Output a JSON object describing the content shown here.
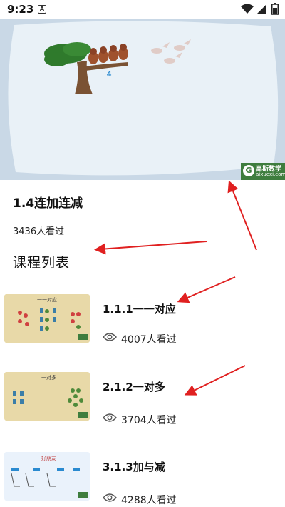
{
  "status_bar": {
    "time": "9:23",
    "notification_glyph": "A",
    "icons": [
      "wifi-icon",
      "signal-icon",
      "battery-icon"
    ]
  },
  "player": {
    "badge_number": "4",
    "watermark_name": "高斯数学",
    "watermark_url": "aixuexi.com",
    "watermark_logo": "G"
  },
  "course": {
    "title": "1.4连加连减",
    "views": "3436人看过"
  },
  "course_list": {
    "heading": "课程列表",
    "lessons": [
      {
        "title": "1.1.1一一对应",
        "views": "4007人看过",
        "thumb_caption": "一一对应"
      },
      {
        "title": "2.1.2一对多",
        "views": "3704人看过",
        "thumb_caption": "一对多"
      },
      {
        "title": "3.1.3加与减",
        "views": "4288人看过",
        "thumb_caption": "好朋友"
      }
    ]
  },
  "colors": {
    "arrow": "#e02020",
    "video_bg": "#c9d8e6",
    "board": "#e9f1f7",
    "watermark": "#3e7d3e",
    "thumb_bg": "#e8d9a8"
  }
}
